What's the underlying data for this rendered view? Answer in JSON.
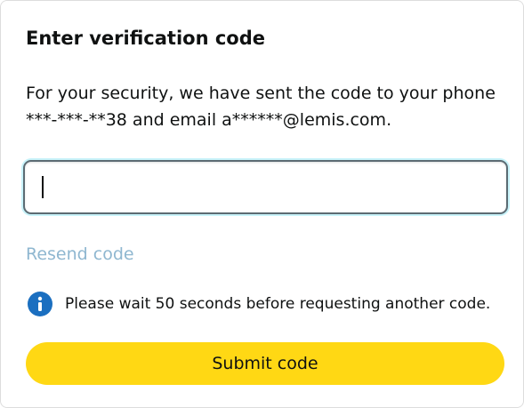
{
  "dialog": {
    "title": "Enter verification code",
    "description": "For your security, we have sent the code to your phone ***-***-**38 and email a******@lemis.com.",
    "code_input": {
      "value": "",
      "placeholder": ""
    },
    "resend_label": "Resend code",
    "notice": {
      "icon": "info-icon",
      "text": "Please wait 50 seconds before requesting another code."
    },
    "submit_label": "Submit code"
  },
  "colors": {
    "title_text": "#0f1111",
    "resend_link_disabled": "#8fb7d0",
    "info_icon": "#1b6fc0",
    "submit_button": "#ffd814",
    "input_focus_ring": "#c8f3fa"
  }
}
